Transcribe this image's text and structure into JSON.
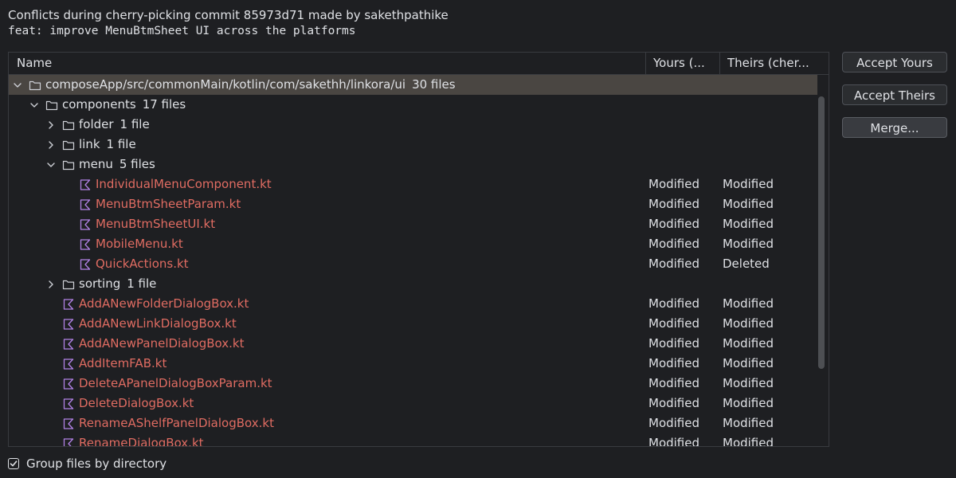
{
  "header": {
    "line1": "Conflicts during cherry-picking commit 85973d71 made by sakethpathike",
    "line2": "feat: improve MenuBtmSheet UI across the platforms"
  },
  "table": {
    "columns": {
      "name": "Name",
      "yours": "Yours (...",
      "theirs": "Theirs (cher..."
    },
    "rows": [
      {
        "kind": "dir",
        "depth": 0,
        "expanded": true,
        "selected": true,
        "name": "composeApp/src/commonMain/kotlin/com/sakethh/linkora/ui",
        "count": "30 files"
      },
      {
        "kind": "dir",
        "depth": 1,
        "expanded": true,
        "name": "components",
        "count": "17 files"
      },
      {
        "kind": "dir",
        "depth": 2,
        "expanded": false,
        "name": "folder",
        "count": "1 file"
      },
      {
        "kind": "dir",
        "depth": 2,
        "expanded": false,
        "name": "link",
        "count": "1 file"
      },
      {
        "kind": "dir",
        "depth": 2,
        "expanded": true,
        "name": "menu",
        "count": "5 files"
      },
      {
        "kind": "file",
        "depth": 3,
        "name": "IndividualMenuComponent.kt",
        "yours": "Modified",
        "theirs": "Modified"
      },
      {
        "kind": "file",
        "depth": 3,
        "name": "MenuBtmSheetParam.kt",
        "yours": "Modified",
        "theirs": "Modified"
      },
      {
        "kind": "file",
        "depth": 3,
        "name": "MenuBtmSheetUI.kt",
        "yours": "Modified",
        "theirs": "Modified"
      },
      {
        "kind": "file",
        "depth": 3,
        "name": "MobileMenu.kt",
        "yours": "Modified",
        "theirs": "Modified"
      },
      {
        "kind": "file",
        "depth": 3,
        "name": "QuickActions.kt",
        "yours": "Modified",
        "theirs": "Deleted"
      },
      {
        "kind": "dir",
        "depth": 2,
        "expanded": false,
        "name": "sorting",
        "count": "1 file"
      },
      {
        "kind": "file",
        "depth": 2,
        "name": "AddANewFolderDialogBox.kt",
        "yours": "Modified",
        "theirs": "Modified"
      },
      {
        "kind": "file",
        "depth": 2,
        "name": "AddANewLinkDialogBox.kt",
        "yours": "Modified",
        "theirs": "Modified"
      },
      {
        "kind": "file",
        "depth": 2,
        "name": "AddANewPanelDialogBox.kt",
        "yours": "Modified",
        "theirs": "Modified"
      },
      {
        "kind": "file",
        "depth": 2,
        "name": "AddItemFAB.kt",
        "yours": "Modified",
        "theirs": "Modified"
      },
      {
        "kind": "file",
        "depth": 2,
        "name": "DeleteAPanelDialogBoxParam.kt",
        "yours": "Modified",
        "theirs": "Modified"
      },
      {
        "kind": "file",
        "depth": 2,
        "name": "DeleteDialogBox.kt",
        "yours": "Modified",
        "theirs": "Modified"
      },
      {
        "kind": "file",
        "depth": 2,
        "name": "RenameAShelfPanelDialogBox.kt",
        "yours": "Modified",
        "theirs": "Modified"
      },
      {
        "kind": "file",
        "depth": 2,
        "name": "RenameDialogBox.kt",
        "yours": "Modified",
        "theirs": "Modified"
      }
    ]
  },
  "buttons": {
    "accept_yours": "Accept Yours",
    "accept_theirs": "Accept Theirs",
    "merge": "Merge..."
  },
  "footer": {
    "group_label": "Group files by directory",
    "group_checked": true
  },
  "colors": {
    "background": "#1e1f22",
    "selected_row": "#4a4642",
    "conflict_file": "#e06c62",
    "kotlin_icon": "#b282e6"
  },
  "icons": {
    "directory": "folder-icon",
    "file": "kotlin-file-icon",
    "expanded": "chevron-down-icon",
    "collapsed": "chevron-right-icon",
    "checkbox": "checkmark-icon"
  }
}
